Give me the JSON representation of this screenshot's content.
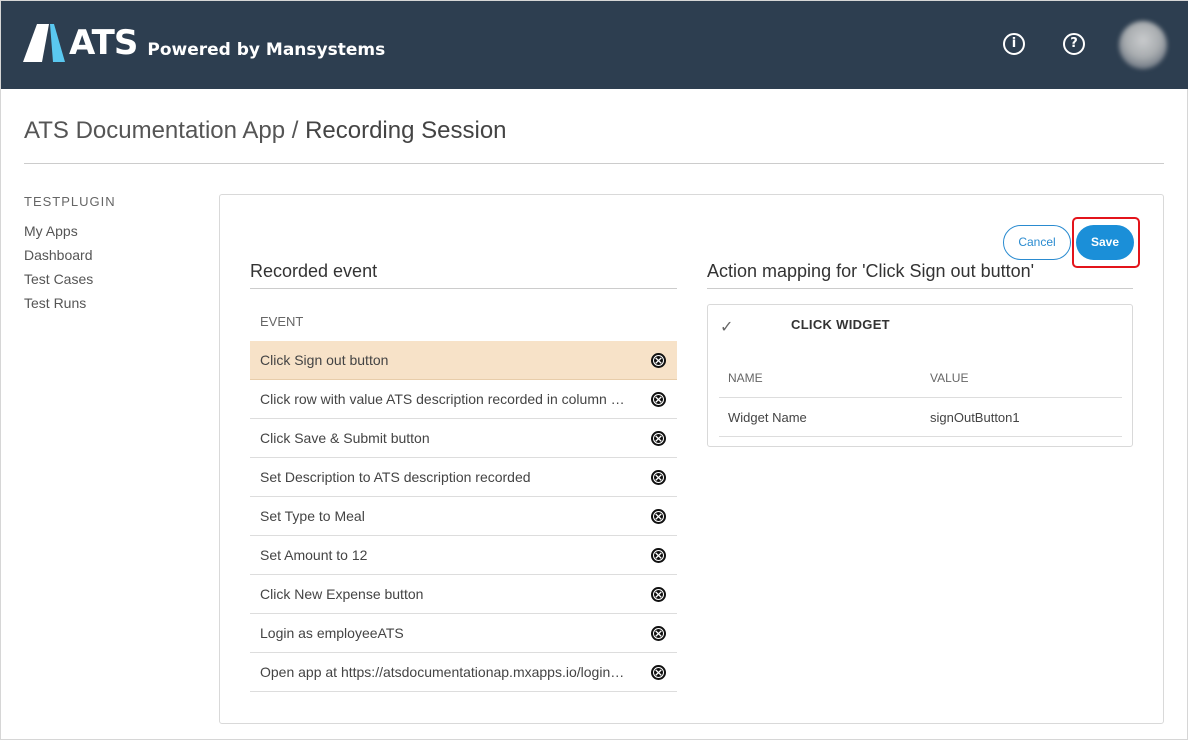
{
  "header": {
    "logo_text": "ATS",
    "logo_subtitle": "Powered by Mansystems",
    "info_icon": "info-icon",
    "help_icon": "help-icon"
  },
  "breadcrumb": {
    "app": "ATS Documentation App",
    "separator": " / ",
    "current": "Recording Session"
  },
  "sidebar": {
    "heading": "TESTPLUGIN",
    "items": [
      {
        "label": "My Apps"
      },
      {
        "label": "Dashboard"
      },
      {
        "label": "Test Cases"
      },
      {
        "label": "Test Runs"
      }
    ]
  },
  "actions": {
    "cancel_label": "Cancel",
    "save_label": "Save"
  },
  "recorded": {
    "title": "Recorded event",
    "column_header": "EVENT",
    "events": [
      {
        "label": "Click Sign out button",
        "selected": true
      },
      {
        "label": "Click row with value ATS description recorded in column column"
      },
      {
        "label": "Click Save & Submit button"
      },
      {
        "label": "Set Description to ATS description recorded"
      },
      {
        "label": "Set Type to Meal"
      },
      {
        "label": "Set Amount to 12"
      },
      {
        "label": "Click New Expense button"
      },
      {
        "label": "Login as employeeATS"
      },
      {
        "label": "Open app at https://atsdocumentationap.mxapps.io/login.html"
      }
    ]
  },
  "mapping": {
    "title": "Action mapping for 'Click Sign out button'",
    "widget_title": "CLICK WIDGET",
    "name_header": "NAME",
    "value_header": "VALUE",
    "rows": [
      {
        "name": "Widget Name",
        "value": "signOutButton1"
      }
    ]
  },
  "colors": {
    "header_bg": "#2d3e50",
    "accent": "#1b8fd8",
    "selected_row": "#f7e2c8",
    "highlight": "#e3141b"
  }
}
